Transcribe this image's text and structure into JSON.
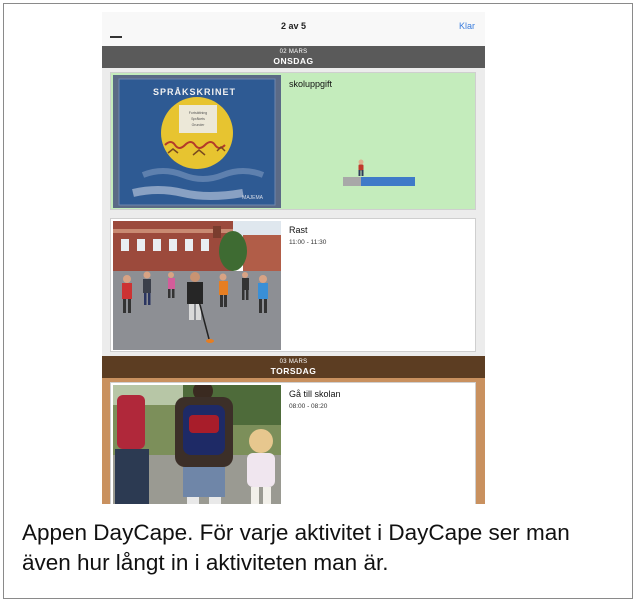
{
  "navbar": {
    "title": "2 av 5",
    "done_label": "Klar"
  },
  "days": [
    {
      "date": "02 MARS",
      "weekday": "ONSDAG",
      "header_color": "#5a5a5a",
      "activities": [
        {
          "title": "skoluppgift",
          "time": "",
          "background": "#c4ecbc",
          "image": "book-cover-sprakskrinet",
          "book_title": "SPRÅKSKRINET",
          "book_lines": [
            "Fortsättning",
            "Språkets",
            "Grunder"
          ],
          "book_publisher": "MAJEMA",
          "progress": 0.25
        },
        {
          "title": "Rast",
          "time": "11:00 - 11:30",
          "background": "#ffffff",
          "image": "schoolyard-kids-playing"
        }
      ]
    },
    {
      "date": "03 MARS",
      "weekday": "TORSDAG",
      "header_color": "#5c3d22",
      "day_background": "#c9915f",
      "activities": [
        {
          "title": "Gå till skolan",
          "time": "08:00 - 08:20",
          "background": "#ffffff",
          "image": "children-walking-to-school"
        }
      ]
    }
  ],
  "caption": "Appen DayCape. För varje aktivitet i DayCape ser man även hur långt in i aktiviteten man är.",
  "colors": {
    "accent": "#3b7ddd",
    "progress_fill": "#3f7ac8",
    "progress_track": "#a8a8a8"
  }
}
